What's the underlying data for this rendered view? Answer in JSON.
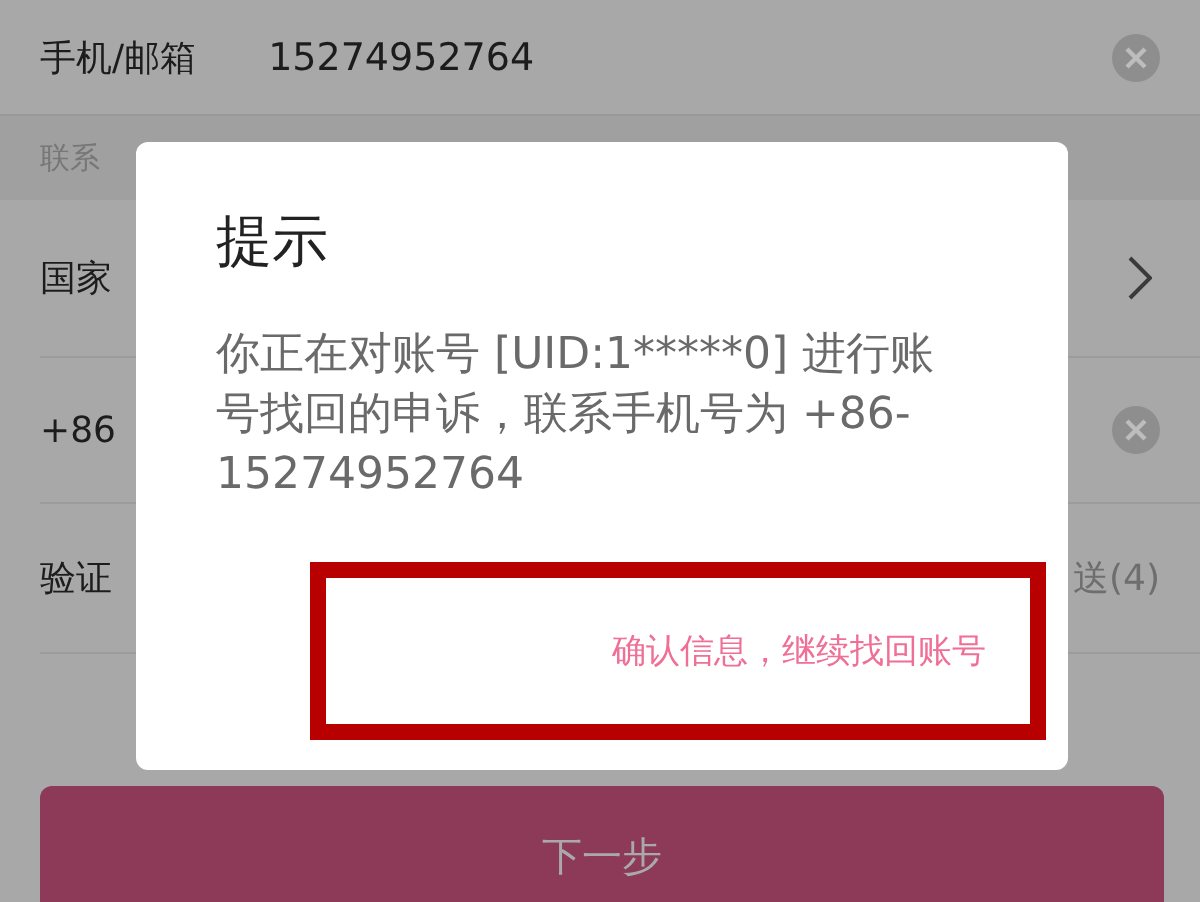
{
  "form": {
    "rows": [
      {
        "kind": "field",
        "label": "手机/邮箱",
        "value": "15274952764",
        "clearable": true
      },
      {
        "kind": "section",
        "label": "联系"
      },
      {
        "kind": "select",
        "label": "国家"
      },
      {
        "kind": "field",
        "label": "+86",
        "clearable": true
      },
      {
        "kind": "code",
        "label": "验证",
        "action": "送(4)"
      }
    ],
    "submit": {
      "label": "下一步",
      "disabled": true
    }
  },
  "dialog": {
    "title": "提示",
    "message": "你正在对账号 [UID:1*****0] 进行账号找回的申诉，联系手机号为 +86-15274952764",
    "confirm": {
      "label": "确认信息，继续找回账号",
      "highlighted": true
    }
  }
}
